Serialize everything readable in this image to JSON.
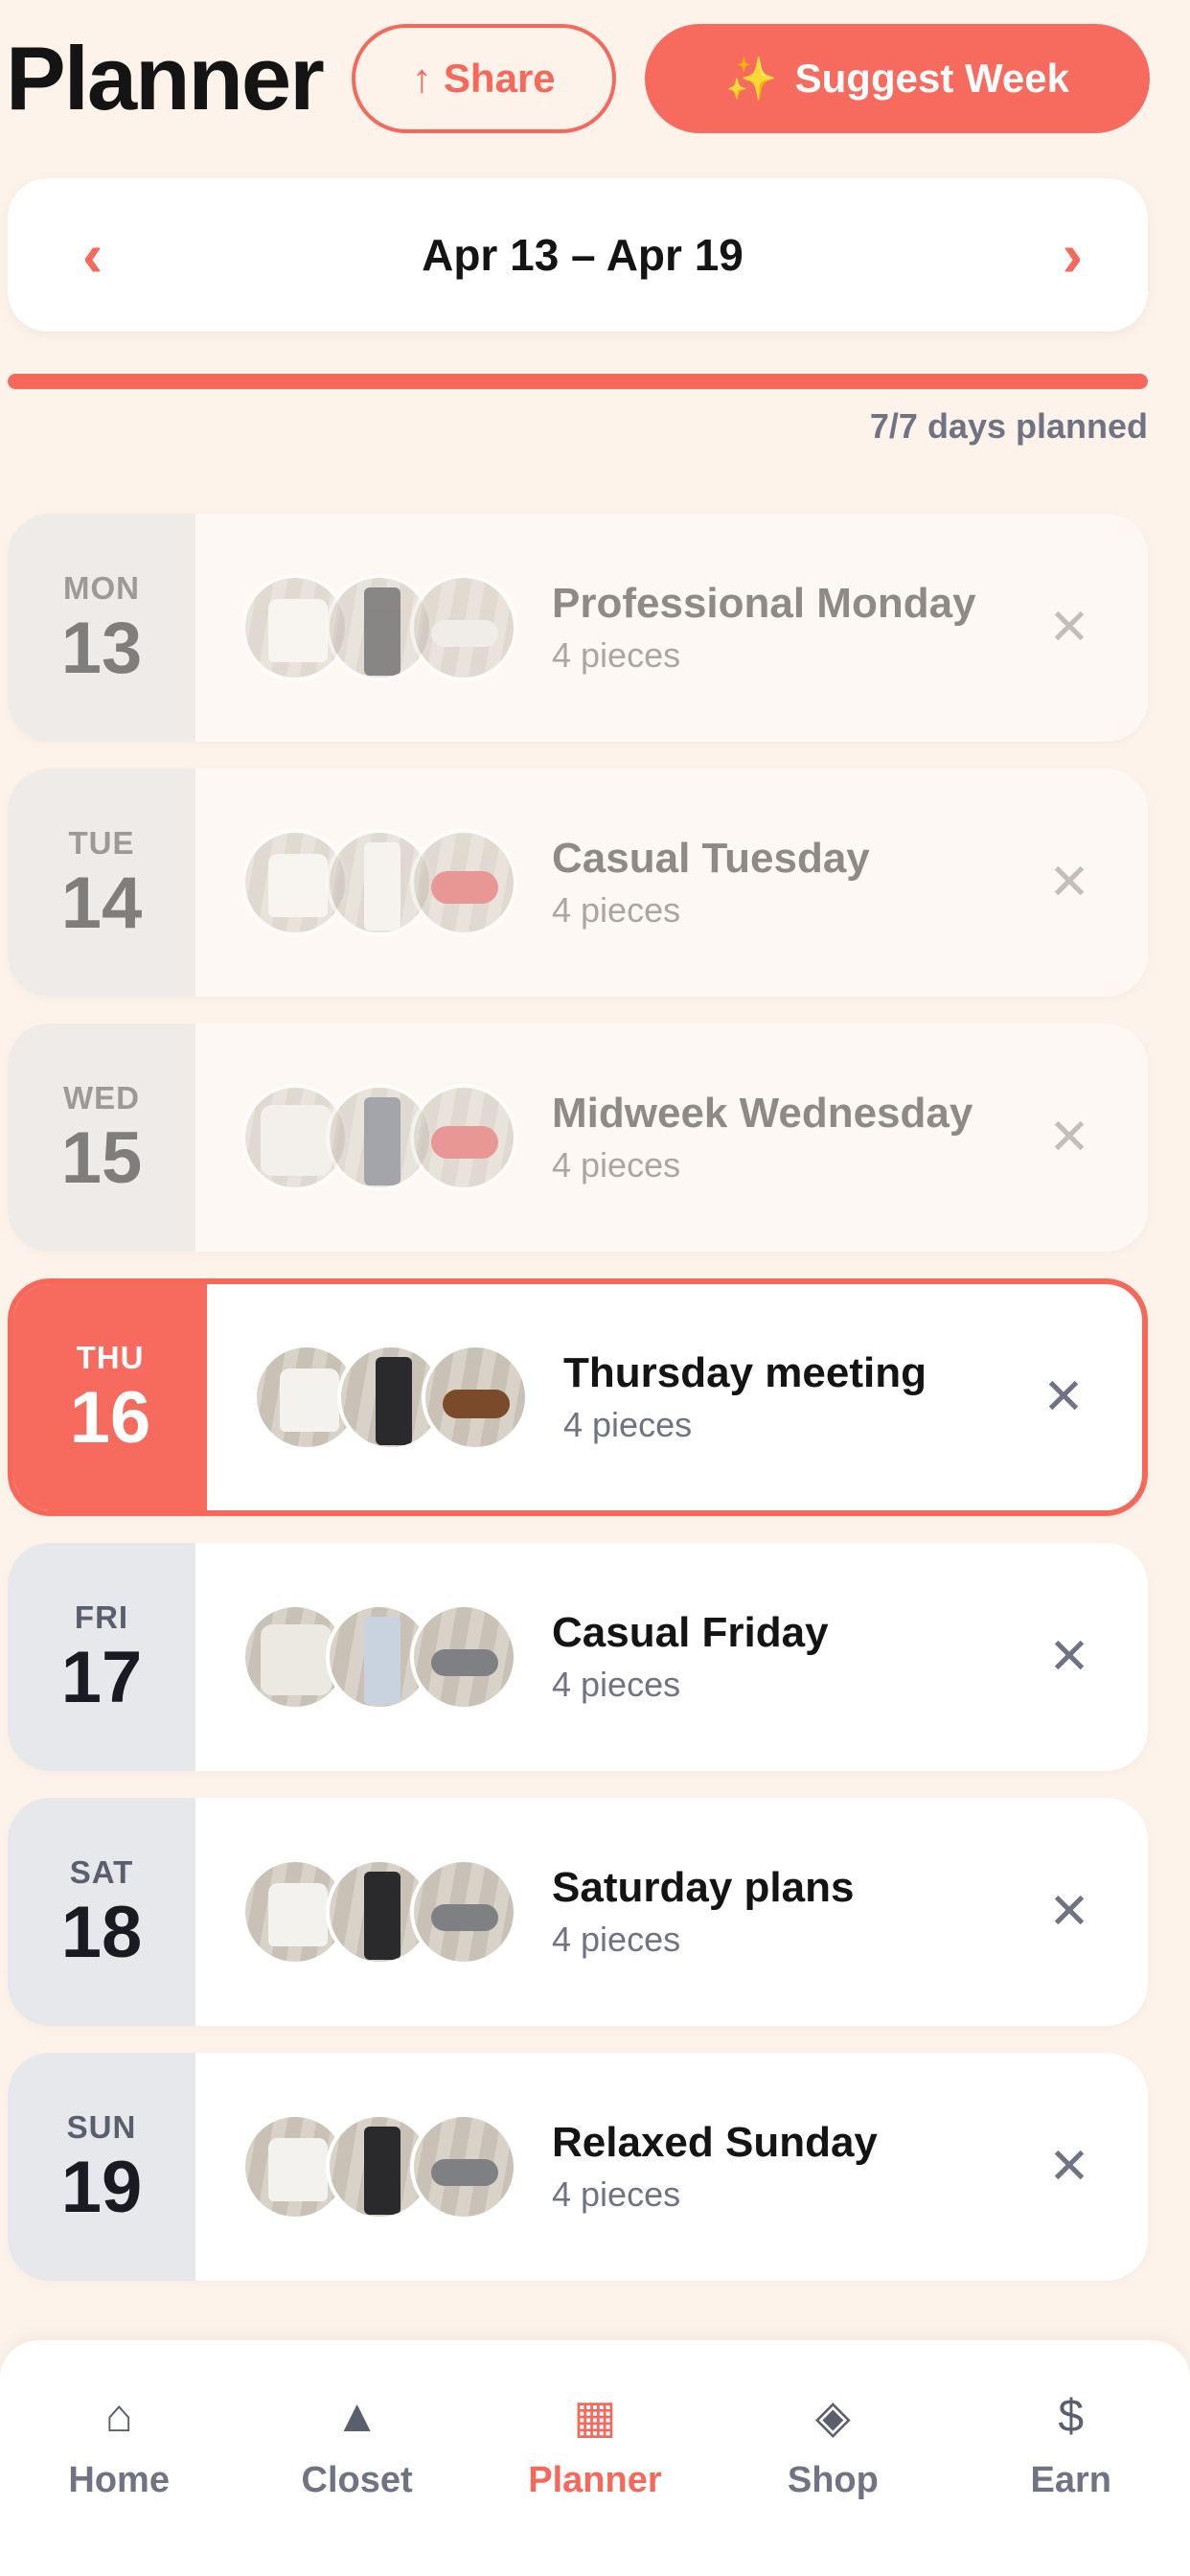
{
  "header": {
    "title": "Planner",
    "share_label": "Share",
    "share_icon": "↑",
    "suggest_label": "Suggest Week",
    "suggest_icon": "✨"
  },
  "week": {
    "prev_icon": "‹",
    "range": "Apr 13 – Apr 19",
    "next_icon": "›",
    "progress_text": "7/7 days planned",
    "planned_fraction": 1.0
  },
  "days": [
    {
      "dow": "MON",
      "num": "13",
      "name": "Professional Monday",
      "pieces": "4 pieces"
    },
    {
      "dow": "TUE",
      "num": "14",
      "name": "Casual Tuesday",
      "pieces": "4 pieces"
    },
    {
      "dow": "WED",
      "num": "15",
      "name": "Midweek Wednesday",
      "pieces": "4 pieces"
    },
    {
      "dow": "THU",
      "num": "16",
      "name": "Thursday meeting",
      "pieces": "4 pieces"
    },
    {
      "dow": "FRI",
      "num": "17",
      "name": "Casual Friday",
      "pieces": "4 pieces"
    },
    {
      "dow": "SAT",
      "num": "18",
      "name": "Saturday plans",
      "pieces": "4 pieces"
    },
    {
      "dow": "SUN",
      "num": "19",
      "name": "Relaxed Sunday",
      "pieces": "4 pieces"
    }
  ],
  "remove_icon": "✕",
  "tabs": [
    {
      "label": "Home",
      "icon": "⌂"
    },
    {
      "label": "Closet",
      "icon": "▲"
    },
    {
      "label": "Planner",
      "icon": "▦"
    },
    {
      "label": "Shop",
      "icon": "◈"
    },
    {
      "label": "Earn",
      "icon": "$"
    }
  ],
  "colors": {
    "accent": "#f5685a",
    "background": "#fdf3ea"
  }
}
